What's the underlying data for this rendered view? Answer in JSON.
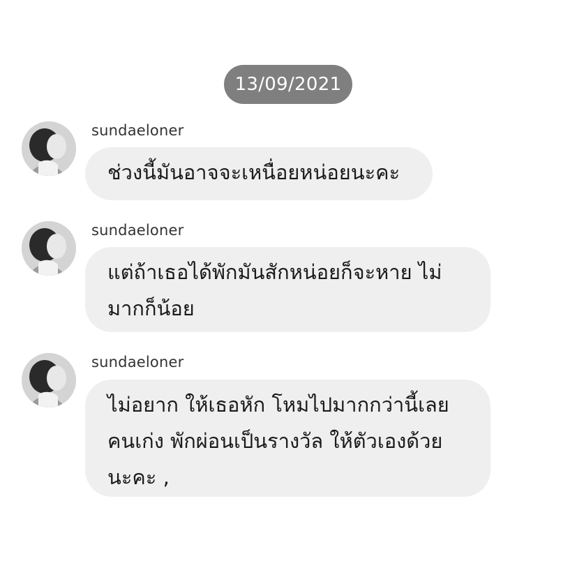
{
  "date_divider": "13/09/2021",
  "messages": [
    {
      "username": "sundaeloner",
      "text": "ช่วงนี้มันอาจจะเหนื่อยหน่อยนะคะ"
    },
    {
      "username": "sundaeloner",
      "text": "แต่ถ้าเธอได้พักมันสักหน่อยก็จะหาย ไม่\nมากก็น้อย"
    },
    {
      "username": "sundaeloner",
      "text": "ไม่อยาก ให้เธอหัก โหมไปมากกว่านี้เลย\nคนเก่ง พักผ่อนเป็นรางวัล ให้ตัวเองด้วย\nนะคะ ,"
    }
  ],
  "colors": {
    "date_pill_bg": "#7f7f7f",
    "bubble_bg": "#efefef",
    "text": "#1a1a1a"
  },
  "icons": {
    "avatar": "profile-photo-avatar"
  }
}
